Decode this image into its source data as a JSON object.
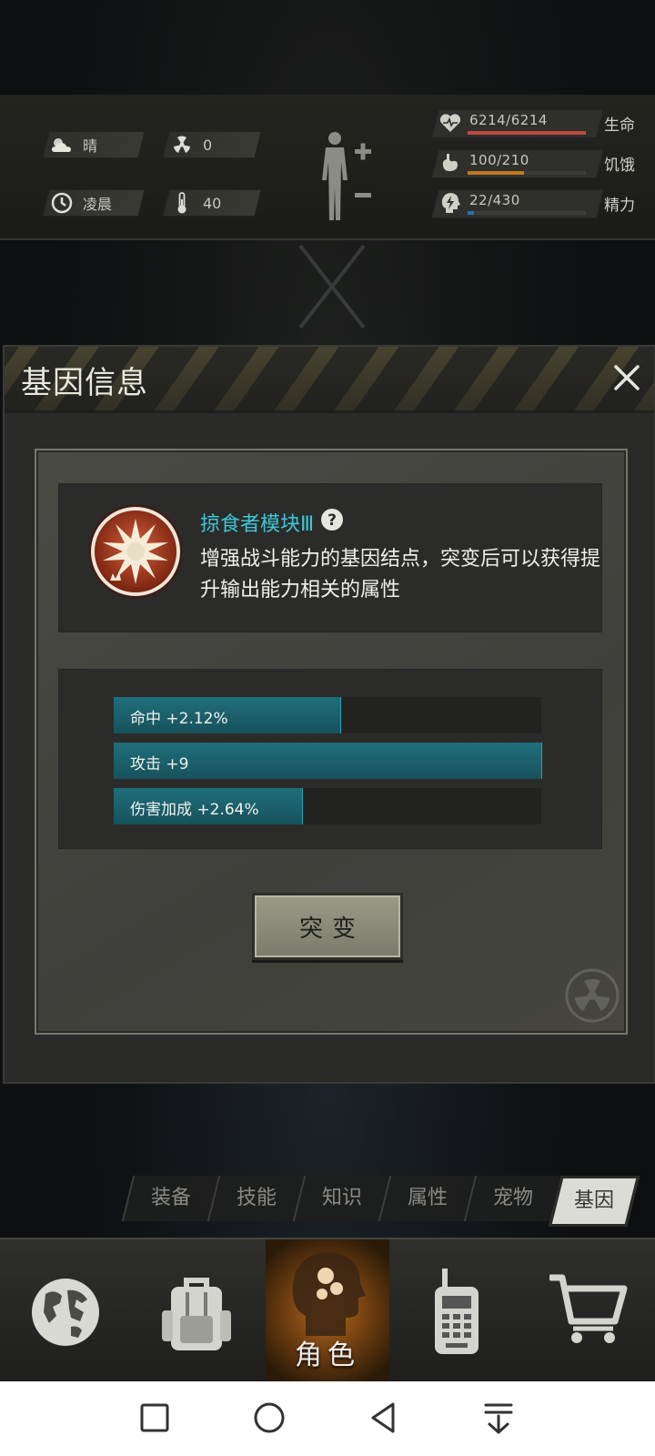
{
  "status": {
    "weather": "晴",
    "radiation": "0",
    "time_of_day": "凌晨",
    "temperature": "40",
    "health": {
      "value": "6214/6214",
      "label": "生命",
      "fraction": 1.0,
      "color": "#c04a3e"
    },
    "hunger": {
      "value": "100/210",
      "label": "饥饿",
      "fraction": 0.476,
      "color": "#c07a22"
    },
    "energy": {
      "value": "22/430",
      "label": "精力",
      "fraction": 0.051,
      "color": "#2f6fb0"
    }
  },
  "modal": {
    "title": "基因信息",
    "gene_name": "掠食者模块Ⅲ",
    "description": "增强战斗能力的基因结点，突变后可以获得提升输出能力相关的属性",
    "attributes": [
      {
        "label": "命中 +2.12%",
        "fraction": 0.53
      },
      {
        "label": "攻击 +9",
        "fraction": 1.0
      },
      {
        "label": "伤害加成 +2.64%",
        "fraction": 0.44
      }
    ],
    "mutate_label": "突变"
  },
  "tabs": [
    {
      "label": "装备",
      "active": false
    },
    {
      "label": "技能",
      "active": false
    },
    {
      "label": "知识",
      "active": false
    },
    {
      "label": "属性",
      "active": false
    },
    {
      "label": "宠物",
      "active": false
    },
    {
      "label": "基因",
      "active": true
    }
  ],
  "bottom_nav": {
    "character_label": "角色"
  }
}
